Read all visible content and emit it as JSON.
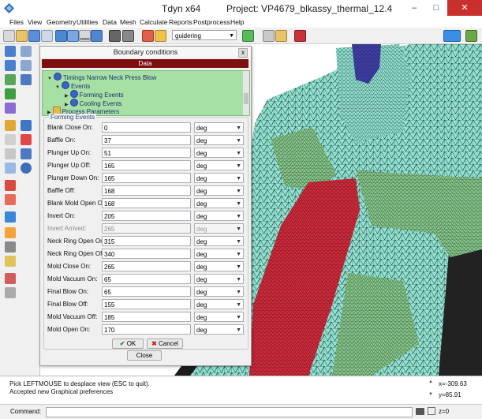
{
  "window": {
    "app_title": "Tdyn x64",
    "project_title": "Project: VP4679_blkassy_thermal_12.4",
    "minimize": "–",
    "maximize": "□",
    "close": "✕"
  },
  "menu": [
    "Files",
    "View",
    "Geometry",
    "Utilities",
    "Data",
    "Mesh",
    "Calculate",
    "Reports",
    "Postprocess",
    "Help"
  ],
  "toolbar": {
    "layer_combo_value": "guidering",
    "zoom_label": "zoom"
  },
  "dialog": {
    "title": "Boundary conditions",
    "close_glyph": "x",
    "data_header": "Data",
    "tree": [
      {
        "label": "Timings Narrow Neck Press Blow",
        "level": 0
      },
      {
        "label": "Events",
        "level": 1
      },
      {
        "label": "Forming Events",
        "level": 2
      },
      {
        "label": "Cooling Events",
        "level": 2
      },
      {
        "label": "Process Parameters",
        "level": 0
      }
    ],
    "section_title": "Forming Events",
    "fields": [
      {
        "label": "Blank Close On:",
        "value": "0",
        "unit": "deg",
        "disabled": false
      },
      {
        "label": "Baffle On:",
        "value": "37",
        "unit": "deg",
        "disabled": false
      },
      {
        "label": "Plunger Up On:",
        "value": "51",
        "unit": "deg",
        "disabled": false
      },
      {
        "label": "Plunger Up Off:",
        "value": "165",
        "unit": "deg",
        "disabled": false
      },
      {
        "label": "Plunger Down On:",
        "value": "165",
        "unit": "deg",
        "disabled": false
      },
      {
        "label": "Baffle Off:",
        "value": "168",
        "unit": "deg",
        "disabled": false
      },
      {
        "label": "Blank Mold Open On:",
        "value": "168",
        "unit": "deg",
        "disabled": false
      },
      {
        "label": "Invert On:",
        "value": "205",
        "unit": "deg",
        "disabled": false
      },
      {
        "label": "Invert Arrived:",
        "value": "265",
        "unit": "deg",
        "disabled": true
      },
      {
        "label": "Neck Ring Open On:",
        "value": "315",
        "unit": "deg",
        "disabled": false
      },
      {
        "label": "Neck Ring Open Off:",
        "value": "340",
        "unit": "deg",
        "disabled": false
      },
      {
        "label": "Mold Close On:",
        "value": "265",
        "unit": "deg",
        "disabled": false
      },
      {
        "label": "Mold Vacuum On:",
        "value": "65",
        "unit": "deg",
        "disabled": false
      },
      {
        "label": "Final Blow On:",
        "value": "65",
        "unit": "deg",
        "disabled": false
      },
      {
        "label": "Final Blow Off:",
        "value": "155",
        "unit": "deg",
        "disabled": false
      },
      {
        "label": "Mold Vacuum Off:",
        "value": "185",
        "unit": "deg",
        "disabled": false
      },
      {
        "label": "Mold Open On:",
        "value": "170",
        "unit": "deg",
        "disabled": false
      }
    ],
    "ok_label": "OK",
    "cancel_label": "Cancel",
    "close_label": "Close"
  },
  "status": {
    "messages": [
      "Pick LEFTMOUSE to desplace view (ESC to quit).",
      "Accepted new Graphical preferences"
    ],
    "coords": [
      "x=-309.63",
      "y=85.91",
      "z=0"
    ]
  },
  "command": {
    "label": "Command:",
    "value": ""
  },
  "colors": {
    "dialog_header": "#7d0f0f",
    "tree_bg": "#a7e0a4",
    "mesh_cyan": "#8fe3d2",
    "mesh_red": "#d8283a",
    "mesh_green": "#86c98a",
    "mesh_blue": "#3f3fb0"
  }
}
